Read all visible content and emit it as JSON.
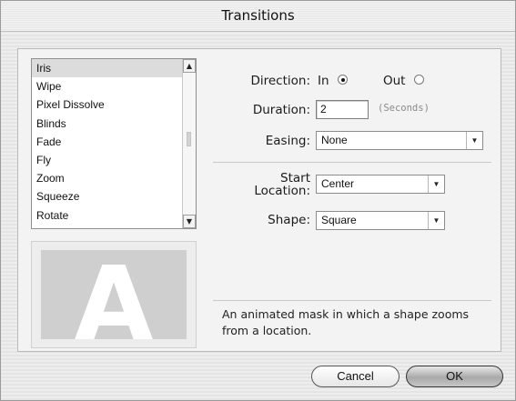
{
  "window": {
    "title": "Transitions"
  },
  "transitions": {
    "items": [
      "Iris",
      "Wipe",
      "Pixel Dissolve",
      "Blinds",
      "Fade",
      "Fly",
      "Zoom",
      "Squeeze",
      "Rotate"
    ],
    "selected": "Iris"
  },
  "preview": {
    "letter": "A"
  },
  "settings": {
    "direction_label": "Direction:",
    "in_label": "In",
    "out_label": "Out",
    "direction_selected": "In",
    "duration_label": "Duration:",
    "duration_value": "2",
    "duration_unit": "(Seconds)",
    "easing_label": "Easing:",
    "easing_value": "None",
    "start_location_label_1": "Start",
    "start_location_label_2": "Location:",
    "start_location_value": "Center",
    "shape_label": "Shape:",
    "shape_value": "Square"
  },
  "description": {
    "line1": "An animated mask in which a shape zooms",
    "line2": "from a location."
  },
  "buttons": {
    "cancel": "Cancel",
    "ok": "OK"
  },
  "icons": {
    "scroll_up": "scroll-up-arrow-icon",
    "scroll_down": "scroll-down-arrow-icon",
    "dropdown": "chevron-down-icon"
  }
}
